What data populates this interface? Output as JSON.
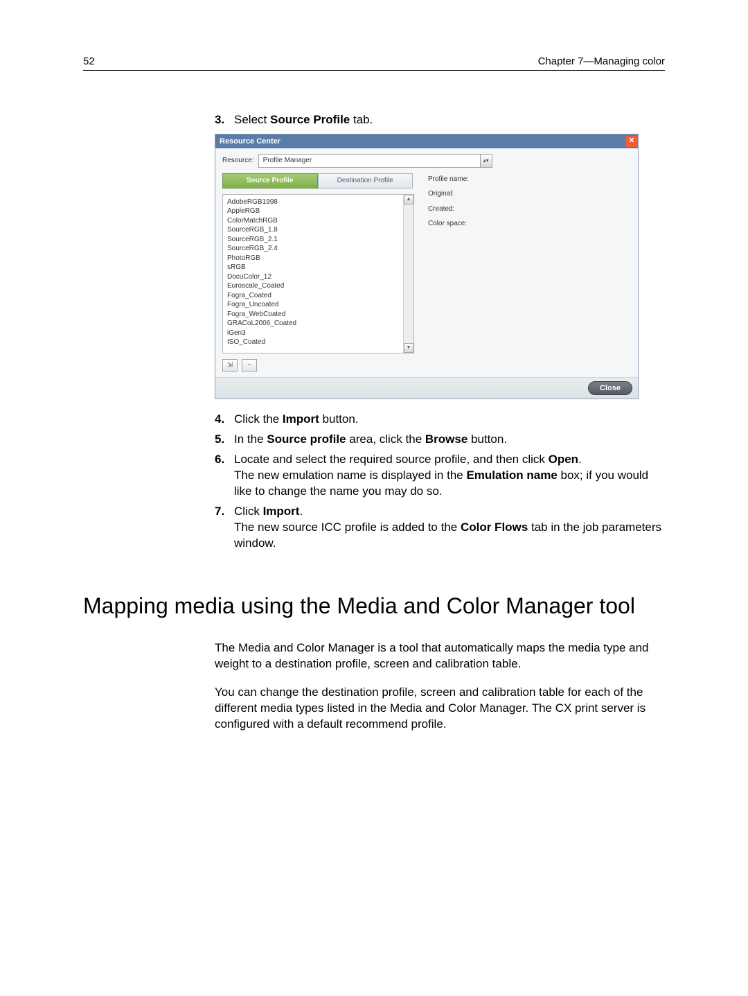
{
  "header": {
    "page_number": "52",
    "chapter": "Chapter 7—Managing color"
  },
  "steps": {
    "s3_num": "3.",
    "s3_pre": "Select ",
    "s3_b1": "Source Profile",
    "s3_post": " tab.",
    "s4_num": "4.",
    "s4_pre": "Click the ",
    "s4_b1": "Import",
    "s4_post": " button.",
    "s5_num": "5.",
    "s5_pre": "In the ",
    "s5_b1": "Source profile",
    "s5_mid": " area, click the ",
    "s5_b2": "Browse",
    "s5_post": " button.",
    "s6_num": "6.",
    "s6_pre": "Locate and select the required source profile, and then click ",
    "s6_b1": "Open",
    "s6_post": ".",
    "s6_note_pre": "The new emulation name is displayed in the ",
    "s6_note_b": "Emulation name",
    "s6_note_post": " box; if you would like to change the name you may do so.",
    "s7_num": "7.",
    "s7_pre": "Click ",
    "s7_b1": "Import",
    "s7_post": ".",
    "s7_note_pre": "The new source ICC profile is added to the ",
    "s7_note_b": "Color Flows",
    "s7_note_post": " tab in the job parameters window."
  },
  "dialog": {
    "title": "Resource Center",
    "resource_label": "Resource:",
    "resource_value": "Profile Manager",
    "tabs": {
      "source": "Source Profile",
      "destination": "Destination Profile"
    },
    "profiles": [
      "AdobeRGB1998",
      "AppleRGB",
      "ColorMatchRGB",
      "SourceRGB_1.8",
      "SourceRGB_2.1",
      "SourceRGB_2.4",
      "PhotoRGB",
      "sRGB",
      "DocuColor_12",
      "Euroscale_Coated",
      "Fogra_Coated",
      "Fogra_Uncoated",
      "Fogra_WebCoated",
      "GRACoL2006_Coated",
      "iGen3",
      "ISO_Coated"
    ],
    "meta": {
      "profile_name": "Profile name:",
      "original": "Original:",
      "created": "Created:",
      "color_space": "Color space:"
    },
    "close_label": "Close"
  },
  "section": {
    "heading": "Mapping media using the Media and Color Manager tool",
    "p1": "The Media and Color Manager is a tool that automatically maps the media type and weight to a destination profile, screen and calibration table.",
    "p2": "You can change the destination profile, screen and calibration table for each of the different media types listed in the Media and Color Manager. The CX print server is configured with a default recommend profile."
  }
}
